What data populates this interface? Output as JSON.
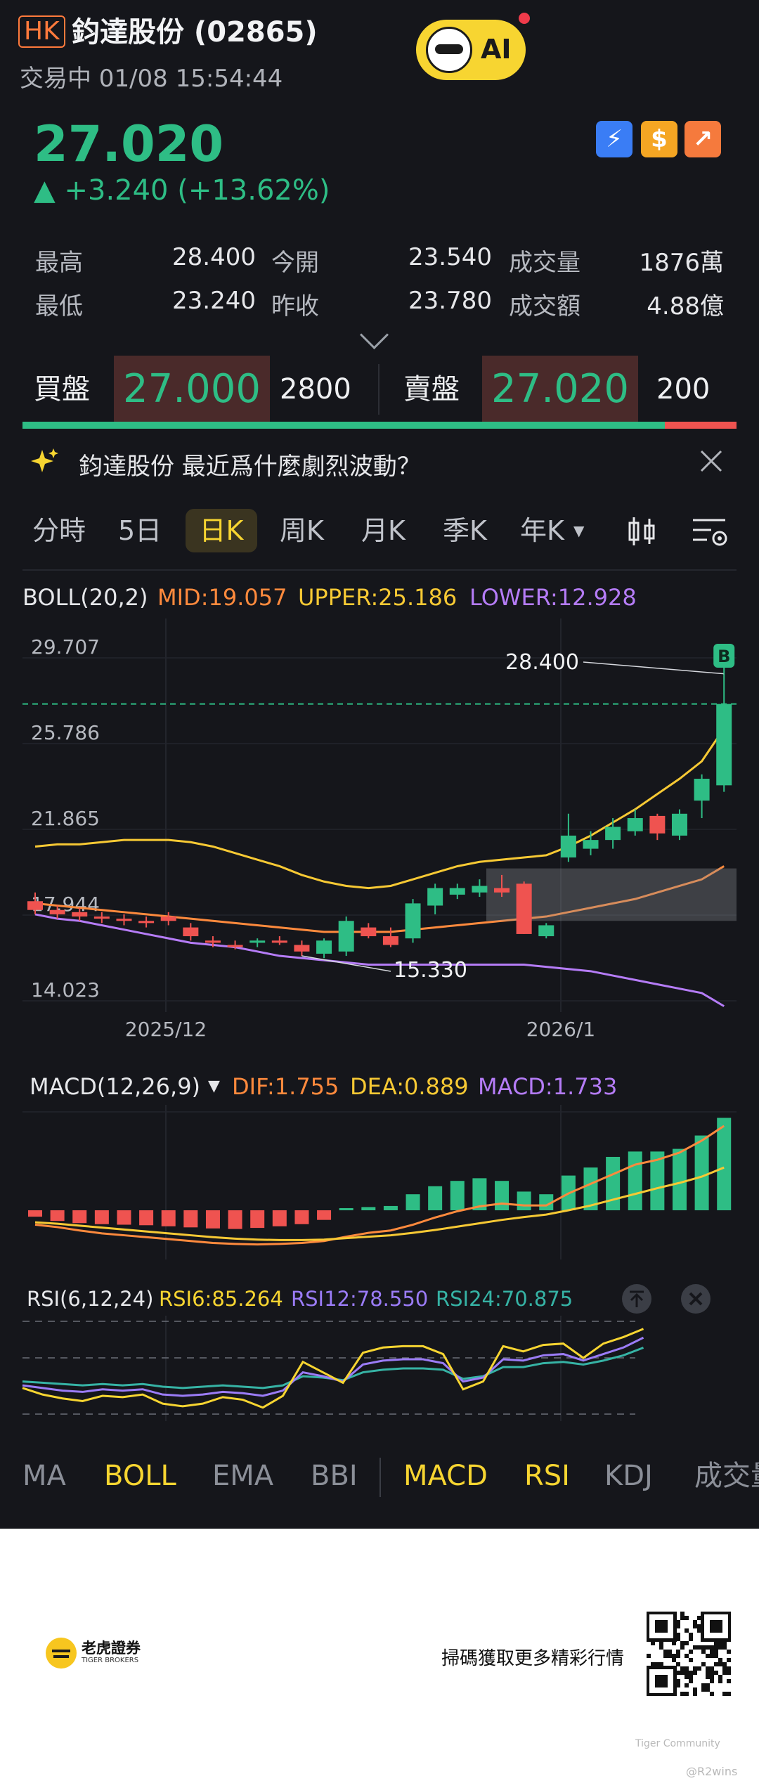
{
  "header": {
    "market_badge": "HK",
    "stock_title": "鈞達股份 (02865)",
    "status_line": "交易中 01/08 15:54:44",
    "ai_label": "AI"
  },
  "quote": {
    "price": "27.020",
    "change": "▲ +3.240 (+13.62%)",
    "stats": [
      {
        "label": "最高",
        "value": "28.400"
      },
      {
        "label": "今開",
        "value": "23.540"
      },
      {
        "label": "成交量",
        "value": "1876萬"
      },
      {
        "label": "最低",
        "value": "23.240"
      },
      {
        "label": "昨收",
        "value": "23.780"
      },
      {
        "label": "成交額",
        "value": "4.88億"
      }
    ]
  },
  "orderbook": {
    "bid_label": "買盤",
    "bid_price": "27.000",
    "bid_qty": "2800",
    "ask_label": "賣盤",
    "ask_price": "27.020",
    "ask_qty": "200",
    "bid_ratio": 0.9
  },
  "news": {
    "text": "鈞達股份 最近爲什麼劇烈波動？"
  },
  "tabs": [
    "分時",
    "5日",
    "日K",
    "周K",
    "月K",
    "季K",
    "年K"
  ],
  "selected_tab": "日K",
  "boll": {
    "label": "BOLL(20,2)",
    "mid": "MID:19.057",
    "upper": "UPPER:25.186",
    "lower": "LOWER:12.928"
  },
  "chart_data": [
    {
      "type": "candlestick",
      "title": "BOLL(20,2)",
      "y_ticks": [
        "29.707",
        "25.786",
        "21.865",
        "17.944",
        "14.023"
      ],
      "x_ticks": [
        "2025/12",
        "2026/1"
      ],
      "annotations": {
        "high": "28.400",
        "low": "15.330",
        "marker": "B"
      },
      "last_price_line": 27.02,
      "candles": [
        {
          "o": 18.0,
          "h": 18.4,
          "l": 17.4,
          "c": 17.6
        },
        {
          "o": 17.6,
          "h": 17.8,
          "l": 17.2,
          "c": 17.4
        },
        {
          "o": 17.5,
          "h": 17.7,
          "l": 17.1,
          "c": 17.3
        },
        {
          "o": 17.3,
          "h": 17.5,
          "l": 17.0,
          "c": 17.2
        },
        {
          "o": 17.2,
          "h": 17.4,
          "l": 16.9,
          "c": 17.1
        },
        {
          "o": 17.1,
          "h": 17.3,
          "l": 16.8,
          "c": 17.0
        },
        {
          "o": 17.3,
          "h": 17.5,
          "l": 16.9,
          "c": 17.1
        },
        {
          "o": 16.8,
          "h": 17.0,
          "l": 16.2,
          "c": 16.4
        },
        {
          "o": 16.2,
          "h": 16.4,
          "l": 15.9,
          "c": 16.1
        },
        {
          "o": 16.0,
          "h": 16.2,
          "l": 15.8,
          "c": 15.9
        },
        {
          "o": 16.1,
          "h": 16.3,
          "l": 15.9,
          "c": 16.2
        },
        {
          "o": 16.2,
          "h": 16.4,
          "l": 16.0,
          "c": 16.1
        },
        {
          "o": 16.0,
          "h": 16.2,
          "l": 15.5,
          "c": 15.7
        },
        {
          "o": 15.6,
          "h": 16.3,
          "l": 15.4,
          "c": 16.2
        },
        {
          "o": 15.7,
          "h": 17.3,
          "l": 15.5,
          "c": 17.1
        },
        {
          "o": 16.8,
          "h": 17.0,
          "l": 16.3,
          "c": 16.4
        },
        {
          "o": 16.4,
          "h": 16.8,
          "l": 15.9,
          "c": 16.0
        },
        {
          "o": 16.3,
          "h": 18.1,
          "l": 16.1,
          "c": 17.9
        },
        {
          "o": 17.8,
          "h": 18.8,
          "l": 17.4,
          "c": 18.6
        },
        {
          "o": 18.3,
          "h": 18.8,
          "l": 18.1,
          "c": 18.6
        },
        {
          "o": 18.4,
          "h": 19.0,
          "l": 18.2,
          "c": 18.7
        },
        {
          "o": 18.6,
          "h": 19.2,
          "l": 18.2,
          "c": 18.4
        },
        {
          "o": 18.8,
          "h": 18.9,
          "l": 16.5,
          "c": 16.5
        },
        {
          "o": 16.4,
          "h": 17.0,
          "l": 16.3,
          "c": 16.9
        },
        {
          "o": 20.0,
          "h": 22.0,
          "l": 19.8,
          "c": 21.0
        },
        {
          "o": 20.4,
          "h": 21.2,
          "l": 20.1,
          "c": 20.8
        },
        {
          "o": 20.8,
          "h": 21.8,
          "l": 20.4,
          "c": 21.4
        },
        {
          "o": 21.2,
          "h": 22.2,
          "l": 21.0,
          "c": 21.8
        },
        {
          "o": 21.9,
          "h": 22.0,
          "l": 20.8,
          "c": 21.1
        },
        {
          "o": 21.0,
          "h": 22.2,
          "l": 20.8,
          "c": 22.0
        },
        {
          "o": 22.6,
          "h": 23.8,
          "l": 21.8,
          "c": 23.6
        },
        {
          "o": 23.3,
          "h": 28.4,
          "l": 23.0,
          "c": 27.02
        }
      ],
      "boll_mid": [
        17.9,
        17.8,
        17.7,
        17.6,
        17.5,
        17.4,
        17.3,
        17.2,
        17.1,
        17.0,
        16.9,
        16.8,
        16.7,
        16.6,
        16.6,
        16.6,
        16.6,
        16.7,
        16.8,
        16.9,
        17.0,
        17.1,
        17.2,
        17.3,
        17.5,
        17.7,
        17.9,
        18.1,
        18.4,
        18.7,
        19.0,
        19.6
      ],
      "boll_upper": [
        20.5,
        20.6,
        20.6,
        20.7,
        20.8,
        20.8,
        20.8,
        20.7,
        20.5,
        20.2,
        19.9,
        19.6,
        19.2,
        18.9,
        18.7,
        18.6,
        18.7,
        19.0,
        19.3,
        19.6,
        19.8,
        19.9,
        20.0,
        20.1,
        20.5,
        21.0,
        21.6,
        22.2,
        22.9,
        23.6,
        24.4,
        25.9
      ],
      "boll_lower": [
        17.4,
        17.2,
        17.1,
        16.9,
        16.7,
        16.5,
        16.3,
        16.1,
        16.0,
        15.9,
        15.7,
        15.5,
        15.4,
        15.3,
        15.2,
        15.1,
        15.1,
        15.1,
        15.1,
        15.1,
        15.1,
        15.1,
        15.1,
        15.0,
        14.9,
        14.8,
        14.6,
        14.4,
        14.2,
        14.0,
        13.8,
        13.2
      ]
    },
    {
      "type": "bar",
      "title": "MACD(12,26,9)",
      "dif_label": "DIF:1.755",
      "dea_label": "DEA:0.889",
      "macd_label": "MACD:1.733",
      "macd": [
        -0.12,
        -0.2,
        -0.24,
        -0.26,
        -0.27,
        -0.28,
        -0.3,
        -0.32,
        -0.34,
        -0.35,
        -0.33,
        -0.3,
        -0.26,
        -0.18,
        0.04,
        0.06,
        0.08,
        0.3,
        0.45,
        0.55,
        0.6,
        0.55,
        0.35,
        0.3,
        0.65,
        0.8,
        1.0,
        1.1,
        1.1,
        1.15,
        1.4,
        1.73
      ],
      "dif": [
        -0.3,
        -0.35,
        -0.42,
        -0.48,
        -0.52,
        -0.56,
        -0.6,
        -0.64,
        -0.68,
        -0.7,
        -0.71,
        -0.7,
        -0.68,
        -0.64,
        -0.55,
        -0.47,
        -0.42,
        -0.3,
        -0.15,
        -0.02,
        0.08,
        0.14,
        0.1,
        0.1,
        0.35,
        0.55,
        0.75,
        0.95,
        1.05,
        1.2,
        1.45,
        1.755
      ],
      "dea": [
        -0.25,
        -0.28,
        -0.32,
        -0.36,
        -0.4,
        -0.44,
        -0.48,
        -0.52,
        -0.56,
        -0.59,
        -0.61,
        -0.62,
        -0.62,
        -0.61,
        -0.58,
        -0.55,
        -0.52,
        -0.47,
        -0.41,
        -0.34,
        -0.27,
        -0.2,
        -0.14,
        -0.09,
        0.0,
        0.1,
        0.22,
        0.34,
        0.46,
        0.57,
        0.7,
        0.889
      ]
    },
    {
      "type": "line",
      "title": "RSI(6,12,24)",
      "rsi6_label": "RSI6:85.264",
      "rsi12_label": "RSI12:78.550",
      "rsi24_label": "RSI24:70.875",
      "rsi6": [
        40,
        35,
        32,
        30,
        34,
        33,
        35,
        28,
        26,
        28,
        33,
        31,
        25,
        34,
        60,
        52,
        44,
        67,
        71,
        72,
        72,
        66,
        39,
        45,
        72,
        68,
        73,
        74,
        63,
        74,
        79,
        85.264
      ],
      "rsi12": [
        42,
        40,
        38,
        37,
        39,
        38,
        39,
        35,
        34,
        35,
        37,
        36,
        34,
        38,
        52,
        49,
        45,
        58,
        61,
        62,
        62,
        59,
        45,
        48,
        62,
        61,
        65,
        66,
        61,
        66,
        71,
        78.55
      ],
      "rsi24": [
        45,
        44,
        43,
        42,
        43,
        42,
        43,
        41,
        40,
        41,
        42,
        41,
        40,
        42,
        49,
        48,
        46,
        52,
        54,
        55,
        55,
        54,
        47,
        49,
        56,
        56,
        59,
        60,
        58,
        61,
        65,
        70.875
      ]
    }
  ],
  "indicator_tabs": [
    "MA",
    "BOLL",
    "EMA",
    "BBI",
    "MACD",
    "RSI",
    "KDJ",
    "成交量"
  ],
  "footer": {
    "brand_cn": "老虎證券",
    "brand_en": "TIGER BROKERS",
    "cta": "掃碼獲取更多精彩行情",
    "community": "Tiger Community",
    "handle": "@R2wins"
  },
  "colors": {
    "up": "#2ebd85",
    "down": "#ef5350",
    "mid": "#ff8a3d",
    "upper": "#f7c934",
    "lower": "#b57cf7",
    "dif": "#ff8a3d",
    "dea": "#f7c934",
    "rsi6": "#f7d531",
    "rsi12": "#9b7cf7",
    "rsi24": "#36b3a5"
  }
}
